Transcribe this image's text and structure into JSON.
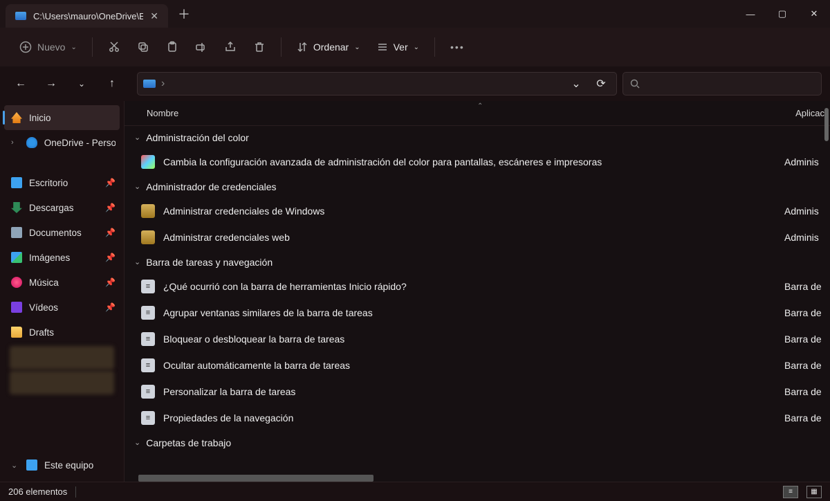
{
  "titlebar": {
    "tab_title": "C:\\Users\\mauro\\OneDrive\\Esc"
  },
  "toolbar": {
    "nuevo": "Nuevo",
    "ordenar": "Ordenar",
    "ver": "Ver"
  },
  "sidebar": {
    "inicio": "Inicio",
    "onedrive": "OneDrive - Perso",
    "escritorio": "Escritorio",
    "descargas": "Descargas",
    "documentos": "Documentos",
    "imagenes": "Imágenes",
    "musica": "Música",
    "videos": "Vídeos",
    "drafts": "Drafts",
    "este_equipo": "Este equipo"
  },
  "columns": {
    "nombre": "Nombre",
    "aplicacion": "Aplicac"
  },
  "groups": [
    {
      "title": "Administración del color",
      "items": [
        {
          "icon": "color",
          "text": "Cambia la configuración avanzada de administración del color para pantallas, escáneres e impresoras",
          "col2": "Adminis"
        }
      ]
    },
    {
      "title": "Administrador de credenciales",
      "items": [
        {
          "icon": "cred",
          "text": "Administrar credenciales de Windows",
          "col2": "Adminis"
        },
        {
          "icon": "cred",
          "text": "Administrar credenciales web",
          "col2": "Adminis"
        }
      ]
    },
    {
      "title": "Barra de tareas y navegación",
      "items": [
        {
          "icon": "doc",
          "text": "¿Qué ocurrió con la barra de herramientas Inicio rápido?",
          "col2": "Barra de"
        },
        {
          "icon": "doc",
          "text": "Agrupar ventanas similares de la barra de tareas",
          "col2": "Barra de"
        },
        {
          "icon": "doc",
          "text": "Bloquear o desbloquear la barra de tareas",
          "col2": "Barra de"
        },
        {
          "icon": "doc",
          "text": "Ocultar automáticamente la barra de tareas",
          "col2": "Barra de"
        },
        {
          "icon": "doc",
          "text": "Personalizar la barra de tareas",
          "col2": "Barra de"
        },
        {
          "icon": "doc",
          "text": "Propiedades de la navegación",
          "col2": "Barra de"
        }
      ]
    },
    {
      "title": "Carpetas de trabajo",
      "items": []
    }
  ],
  "status": {
    "count": "206 elementos"
  }
}
